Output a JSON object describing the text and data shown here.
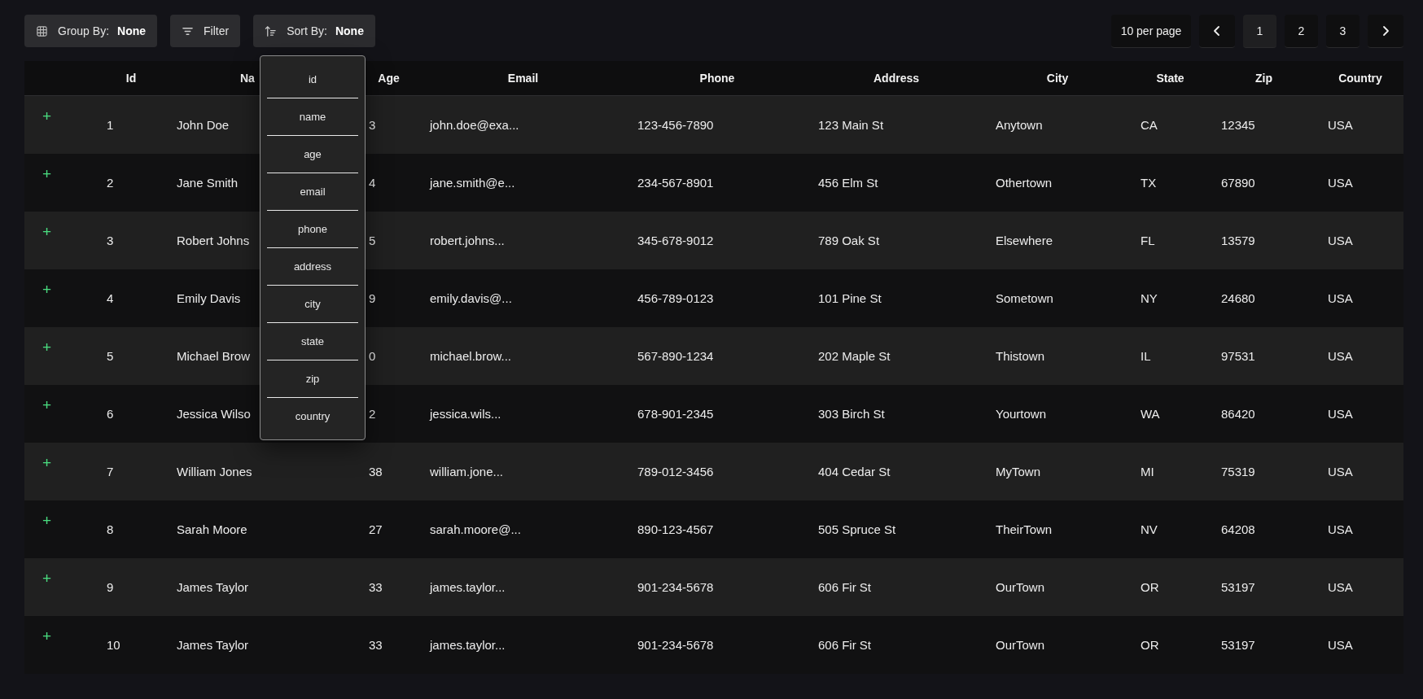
{
  "toolbar": [
    {
      "kind": "group",
      "label": "Group By:",
      "value": "None"
    },
    {
      "kind": "filter",
      "label": "Filter"
    },
    {
      "kind": "sort",
      "label": "Sort By:",
      "value": "None"
    }
  ],
  "pagination": {
    "per_page": "10 per page",
    "pages": [
      {
        "label": "1",
        "selected": true
      },
      {
        "label": "2",
        "selected": false
      },
      {
        "label": "3",
        "selected": false
      }
    ]
  },
  "sort_menu": {
    "items": [
      "id",
      "name",
      "age",
      "email",
      "phone",
      "address",
      "city",
      "state",
      "zip",
      "country"
    ]
  },
  "table": {
    "columns": [
      "Id",
      "Na",
      "Age",
      "Email",
      "Phone",
      "Address",
      "City",
      "State",
      "Zip",
      "Country"
    ],
    "rows": [
      {
        "expander": "+",
        "cells": [
          "1",
          "John Doe",
          "3",
          "john.doe@exa...",
          "123-456-7890",
          "123 Main St",
          "Anytown",
          "CA",
          "12345",
          "USA"
        ]
      },
      {
        "expander": "+",
        "cells": [
          "2",
          "Jane Smith",
          "4",
          "jane.smith@e...",
          "234-567-8901",
          "456 Elm St",
          "Othertown",
          "TX",
          "67890",
          "USA"
        ]
      },
      {
        "expander": "+",
        "cells": [
          "3",
          "Robert Johns",
          "5",
          "robert.johns...",
          "345-678-9012",
          "789 Oak St",
          "Elsewhere",
          "FL",
          "13579",
          "USA"
        ]
      },
      {
        "expander": "+",
        "cells": [
          "4",
          "Emily Davis",
          "9",
          "emily.davis@...",
          "456-789-0123",
          "101 Pine St",
          "Sometown",
          "NY",
          "24680",
          "USA"
        ]
      },
      {
        "expander": "+",
        "cells": [
          "5",
          "Michael Brow",
          "0",
          "michael.brow...",
          "567-890-1234",
          "202 Maple St",
          "Thistown",
          "IL",
          "97531",
          "USA"
        ]
      },
      {
        "expander": "+",
        "cells": [
          "6",
          "Jessica Wilso",
          "2",
          "jessica.wils...",
          "678-901-2345",
          "303 Birch St",
          "Yourtown",
          "WA",
          "86420",
          "USA"
        ]
      },
      {
        "expander": "+",
        "cells": [
          "7",
          "William Jones",
          "38",
          "william.jone...",
          "789-012-3456",
          "404 Cedar St",
          "MyTown",
          "MI",
          "75319",
          "USA"
        ]
      },
      {
        "expander": "+",
        "cells": [
          "8",
          "Sarah Moore",
          "27",
          "sarah.moore@...",
          "890-123-4567",
          "505 Spruce St",
          "TheirTown",
          "NV",
          "64208",
          "USA"
        ]
      },
      {
        "expander": "+",
        "cells": [
          "9",
          "James Taylor",
          "33",
          "james.taylor...",
          "901-234-5678",
          "606 Fir St",
          "OurTown",
          "OR",
          "53197",
          "USA"
        ]
      },
      {
        "expander": "+",
        "cells": [
          "10",
          "James Taylor",
          "33",
          "james.taylor...",
          "901-234-5678",
          "606 Fir St",
          "OurTown",
          "OR",
          "53197",
          "USA"
        ]
      }
    ]
  }
}
